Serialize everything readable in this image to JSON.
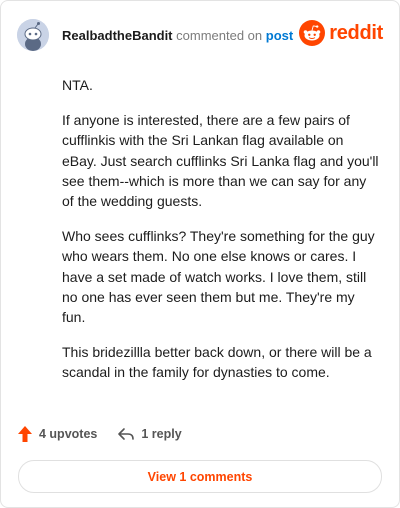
{
  "header": {
    "username": "RealbadtheBandit",
    "verb": "commented on",
    "target": "post",
    "brand": "reddit",
    "avatar_icon": "snoo-avatar-icon",
    "logo_icon": "reddit-alien-icon"
  },
  "comment": {
    "paragraphs": [
      "NTA.",
      "If anyone is interested, there are a few pairs of cufflinkis with the Sri Lankan flag available on eBay. Just search cufflinks Sri Lanka flag and you'll see them--which is more than we can say for any of the wedding guests.",
      "Who sees cufflinks? They're something for the guy who wears them. No one else knows or cares. I have a set made of watch works. I love them, still no one has ever seen them but me. They're my fun.",
      "This bridezillla better back down, or there will be a scandal in the family for dynasties to come."
    ]
  },
  "actions": {
    "upvotes": "4 upvotes",
    "reply": "1 reply",
    "upvote_icon": "upvote-arrow-icon",
    "reply_icon": "reply-arrow-icon"
  },
  "view_comments": "View 1 comments",
  "colors": {
    "brand": "#ff4500",
    "link": "#0079d3",
    "avatar_bg": "#c9d3e6"
  }
}
